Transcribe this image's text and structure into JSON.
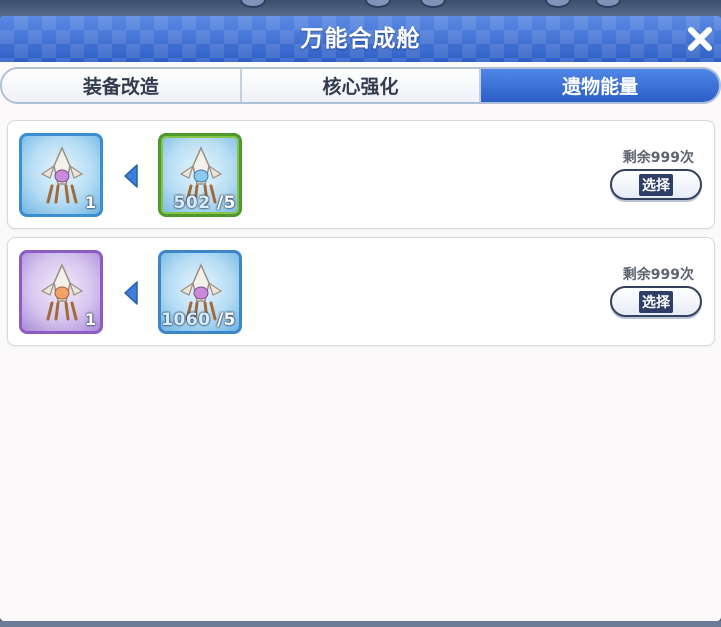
{
  "window": {
    "title": "万能合成舱",
    "close_icon": "close-icon"
  },
  "tabs": [
    {
      "label": "装备改造",
      "active": false
    },
    {
      "label": "核心强化",
      "active": false
    },
    {
      "label": "遗物能量",
      "active": true
    }
  ],
  "recipes": [
    {
      "target": {
        "rarity": "blue",
        "quantity": "1"
      },
      "material": {
        "rarity": "green",
        "have": "502",
        "need": "/5"
      },
      "remaining": "剩余999次",
      "select_label": "选择"
    },
    {
      "target": {
        "rarity": "purple",
        "quantity": "1"
      },
      "material": {
        "rarity": "blue",
        "have": "1060",
        "need": "/5"
      },
      "remaining": "剩余999次",
      "select_label": "选择"
    }
  ],
  "colors": {
    "title_bar": "#3b6fd4",
    "tab_active": "#2c5fc7",
    "arrow": "#3d7fd9",
    "frame_blue": "#3a8fd0",
    "frame_green": "#4d9a2b",
    "frame_purple": "#8a5cc4"
  }
}
